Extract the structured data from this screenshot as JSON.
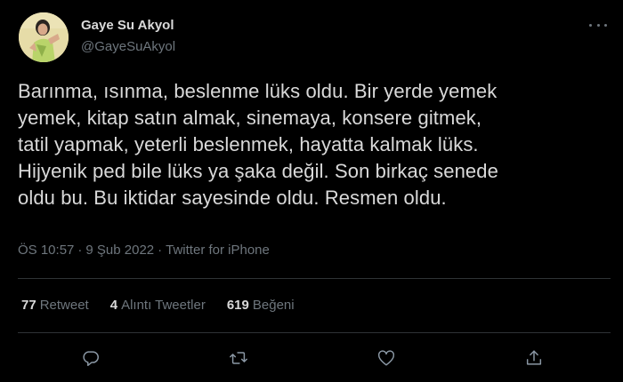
{
  "author": {
    "display_name": "Gaye Su Akyol",
    "handle": "@GayeSuAkyol",
    "avatar_icon": "profile-photo"
  },
  "tweet": {
    "text": "Barınma, ısınma, beslenme lüks oldu. Bir yerde yemek\nyemek, kitap satın almak, sinemaya, konsere gitmek,\ntatil yapmak, yeterli beslenmek, hayatta kalmak lüks.\nHijyenik ped bile lüks ya şaka değil. Son birkaç senede\noldu bu. Bu iktidar sayesinde oldu. Resmen oldu.",
    "time": "ÖS 10:57",
    "separator": "·",
    "date": "9 Şub 2022",
    "source": "Twitter for iPhone"
  },
  "stats": {
    "retweets_count": "77",
    "retweets_label": "Retweet",
    "quotes_count": "4",
    "quotes_label": "Alıntı Tweetler",
    "likes_count": "619",
    "likes_label": "Beğeni"
  },
  "actions": {
    "reply_icon": "reply-icon",
    "retweet_icon": "retweet-icon",
    "like_icon": "heart-icon",
    "share_icon": "share-icon"
  },
  "colors": {
    "background": "#000000",
    "text": "#d9d9d9",
    "secondary_text": "#6e767d",
    "divider": "#2f3336"
  }
}
